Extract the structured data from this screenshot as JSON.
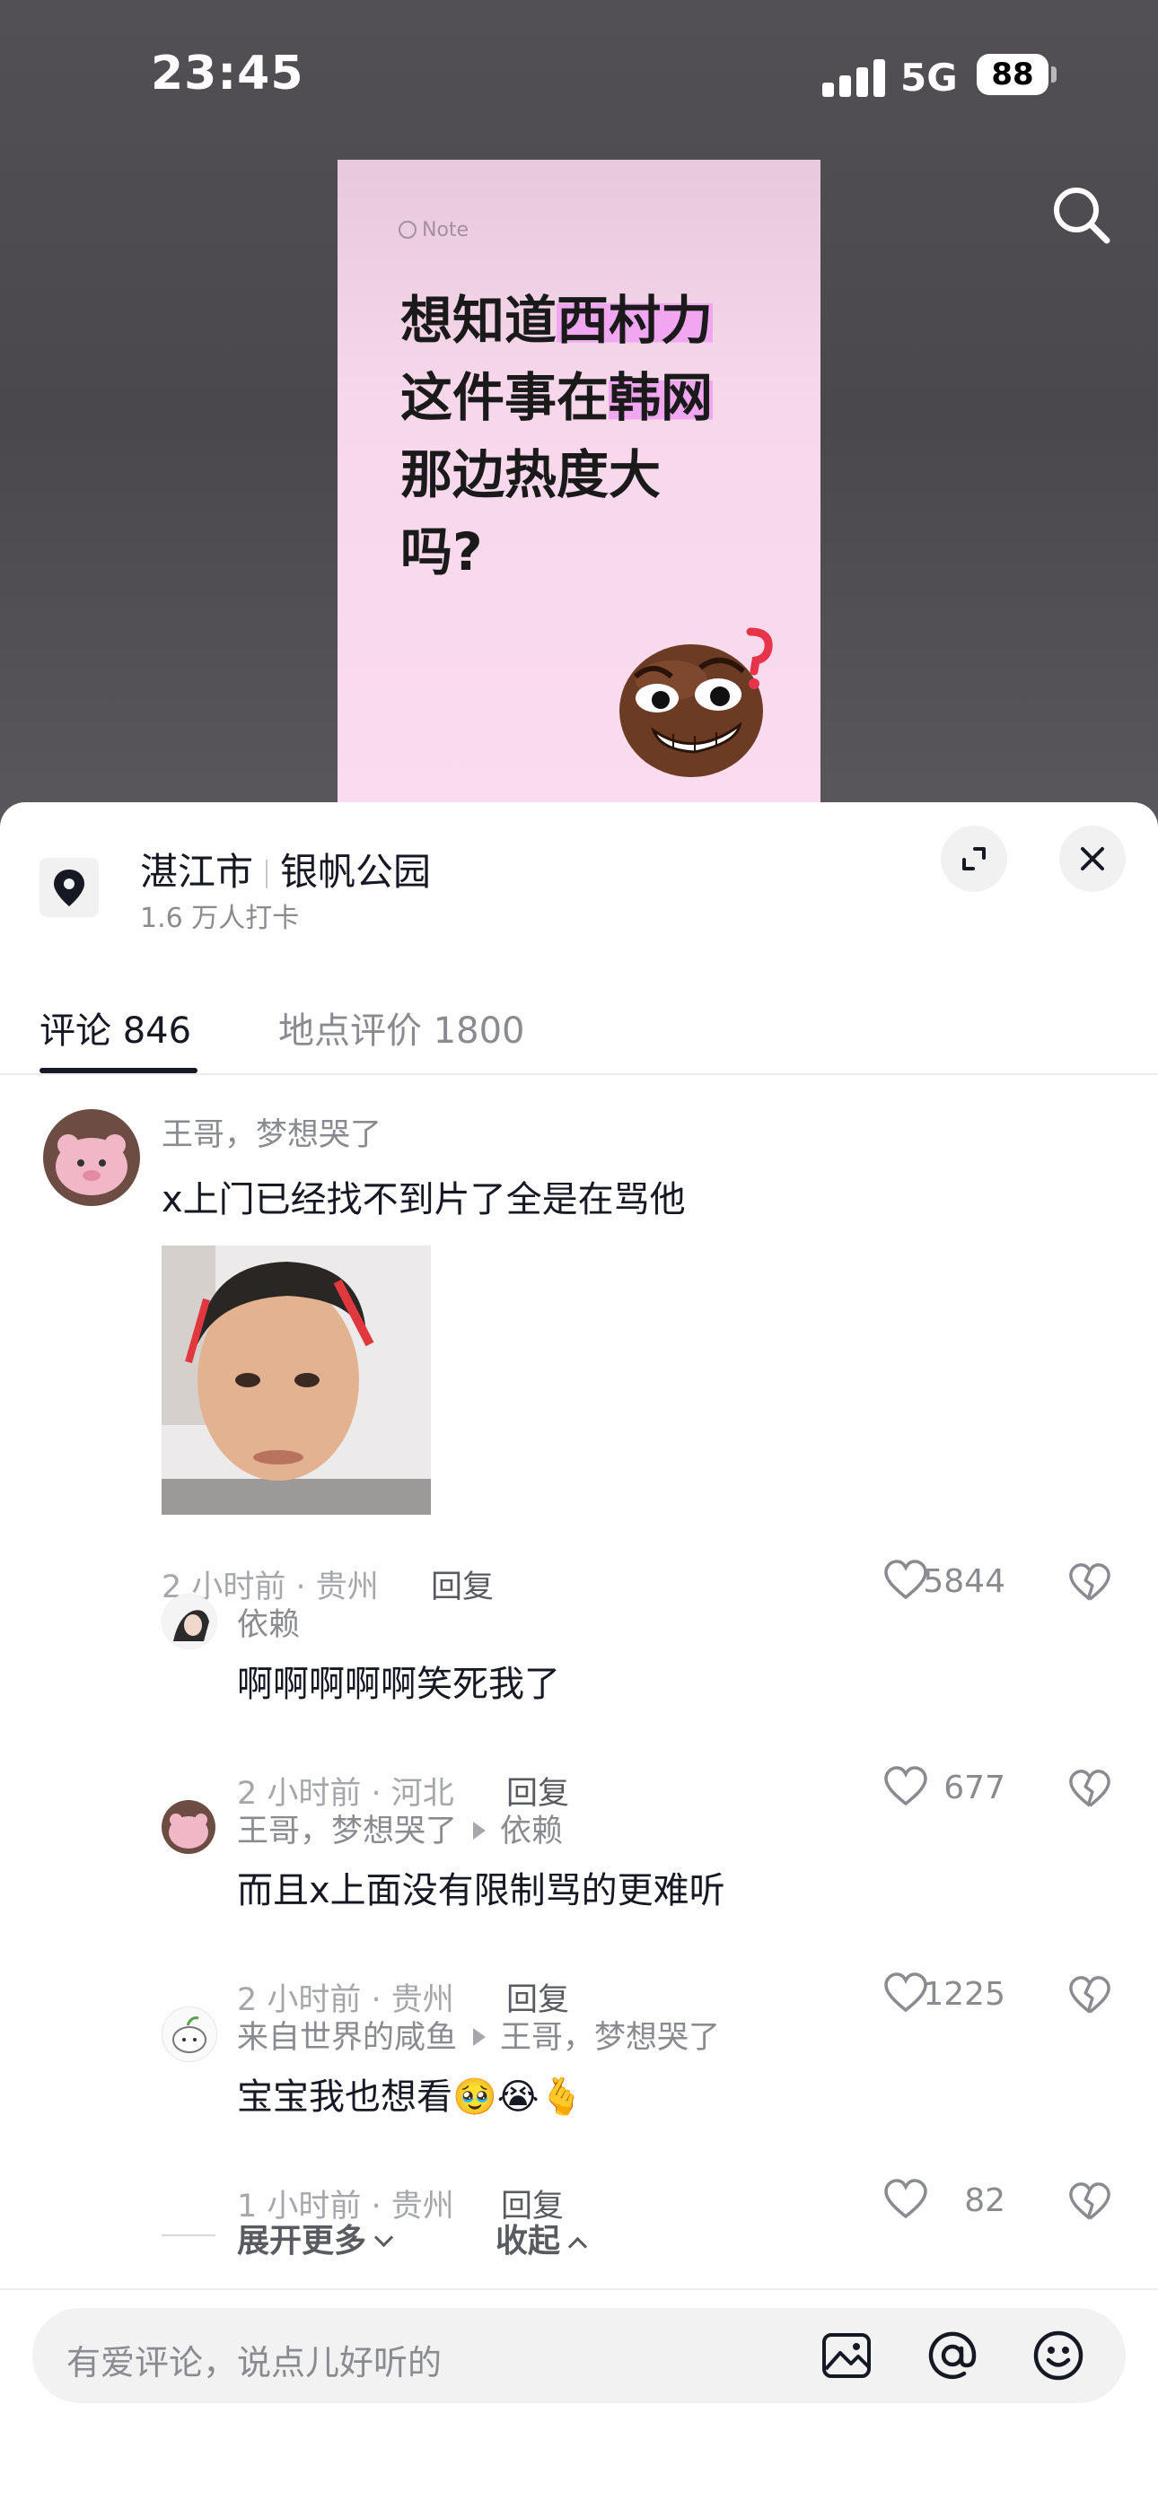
{
  "status_bar": {
    "time": "23:45",
    "network": "5G",
    "battery": "88"
  },
  "note": {
    "tag": "Note",
    "lines": [
      {
        "pre": "想知道",
        "hl": "西村力",
        "post": ""
      },
      {
        "pre": "这件事在",
        "hl": "韩网",
        "post": ""
      },
      {
        "pre": "那边热度大",
        "hl": "",
        "post": ""
      },
      {
        "pre": "吗?",
        "hl": "",
        "post": ""
      }
    ]
  },
  "location": {
    "city": "湛江市",
    "place": "银帆公园",
    "checkins": "1.6 万人打卡"
  },
  "tabs": {
    "comments": "评论 846",
    "reviews": "地点评价 1800"
  },
  "comments": [
    {
      "user": "王哥，梦想哭了",
      "text": "x上门已经找不到片了全是在骂他",
      "has_image": true,
      "time_loc": "2 小时前 · 贵州",
      "reply": "回复",
      "likes": "5844",
      "replies": [
        {
          "user": "依赖",
          "reply_to": "",
          "text": "啊啊啊啊啊笑死我了",
          "time_loc": "2 小时前 · 河北",
          "reply": "回复",
          "likes": "677"
        },
        {
          "user": "王哥，梦想哭了",
          "reply_to": "依赖",
          "text": "而且x上面没有限制骂的更难听",
          "time_loc": "2 小时前 · 贵州",
          "reply": "回复",
          "likes": "1225"
        },
        {
          "user": "来自世界的咸鱼",
          "reply_to": "王哥，梦想哭了",
          "text": "宝宝我也想看🥹😭🫰",
          "time_loc": "1 小时前 · 贵州",
          "reply": "回复",
          "likes": "82"
        }
      ]
    }
  ],
  "expand": {
    "more": "展开更多",
    "collapse": "收起"
  },
  "input": {
    "placeholder": "有爱评论，说点儿好听的"
  },
  "icons": [
    "search-icon",
    "location-pin-icon",
    "expand-icon",
    "close-icon",
    "heart-icon",
    "broken-heart-icon",
    "image-icon",
    "at-icon",
    "emoji-icon"
  ],
  "colors": {
    "highlight": "#f0a7f0",
    "note_bg": "#fbdcee",
    "text": "#161823",
    "secondary": "#8a8b91"
  }
}
